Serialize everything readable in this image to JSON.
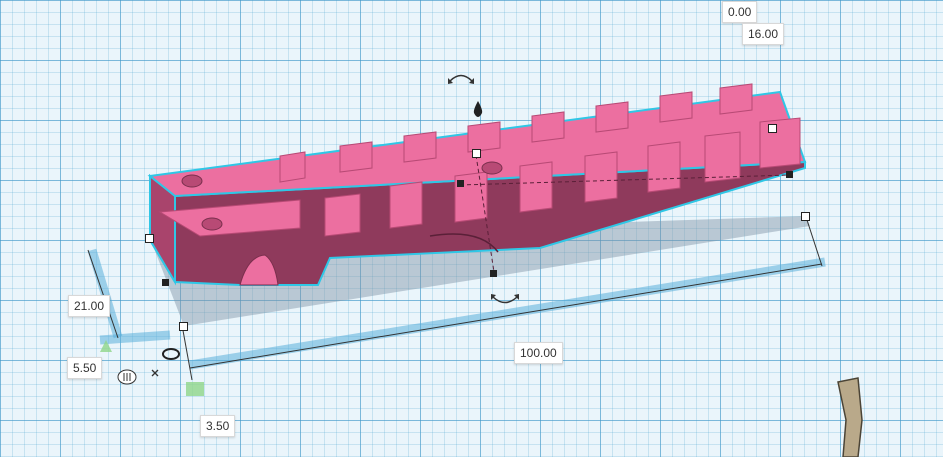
{
  "dimensions": {
    "height_top": "0.00",
    "height": "16.00",
    "width": "21.00",
    "length": "100.00",
    "elevation": "5.50",
    "offset": "3.50"
  },
  "colors": {
    "shape_top": "#ec6fa0",
    "shape_side": "#b84a75",
    "shape_dark": "#8f3a5c",
    "selection_outline": "#2fc7e6",
    "shadow": "#7f93a3",
    "workplane_grid": "#3c96c8"
  },
  "icons": {
    "rotate_top": "rotate-arrow-icon",
    "drop": "drop-to-workplane-icon",
    "rotate_front": "rotate-arrow-icon",
    "ruler_origin": "ruler-origin-icon",
    "snap_marker": "snap-marker-icon"
  }
}
